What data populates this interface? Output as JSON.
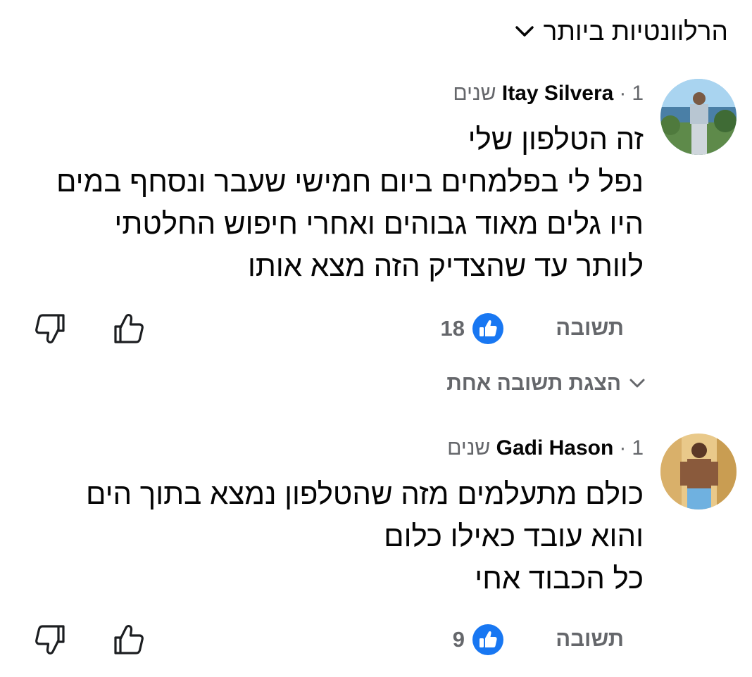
{
  "sort": {
    "label": "הרלוונטיות ביותר",
    "icon": "chevron-down-icon"
  },
  "comments": [
    {
      "author": "Itay Silvera",
      "time": "1 שנים",
      "lines": [
        "זה הטלפון שלי",
        "נפל לי בפלמחים ביום חמישי שעבר ונסחף במים",
        "היו גלים מאוד גבוהים ואחרי חיפוש החלטתי",
        "לוותר עד שהצדיק הזה מצא אותו"
      ],
      "reply_label": "תשובה",
      "like_count": "18"
    },
    {
      "author": "Gadi Hason",
      "time": "1 שנים",
      "lines": [
        "כולם מתעלמים מזה שהטלפון נמצא בתוך הים",
        "והוא עובד כאילו כלום",
        "כל הכבוד אחי"
      ],
      "reply_label": "תשובה",
      "like_count": "9"
    }
  ],
  "show_replies": {
    "label": "הצגת תשובה אחת"
  },
  "colors": {
    "like_blue": "#1877f2",
    "secondary_text": "#65676b",
    "primary_text": "#050505"
  }
}
